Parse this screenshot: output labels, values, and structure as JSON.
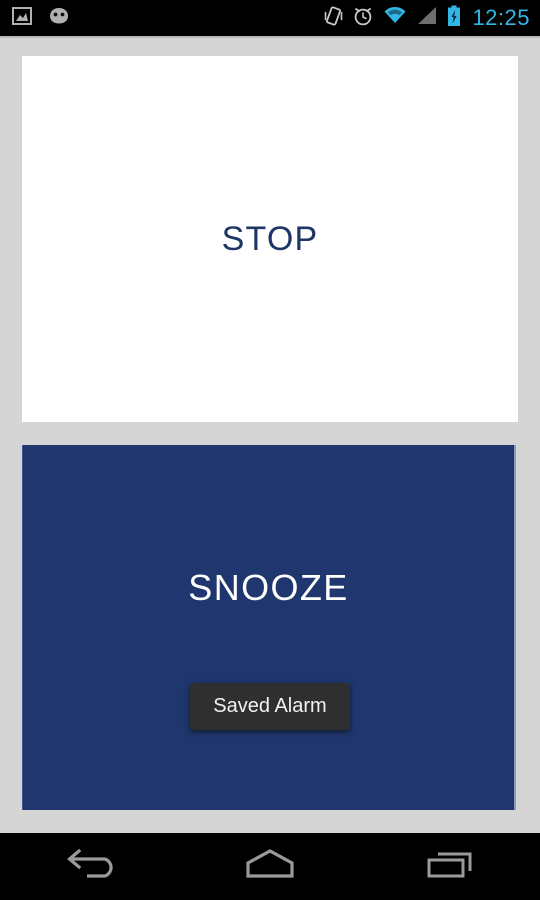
{
  "status_bar": {
    "left_icons": [
      {
        "name": "screenshot-icon",
        "label": "Screenshot"
      },
      {
        "name": "android-head-icon",
        "label": "Android System"
      }
    ],
    "right_icons": [
      {
        "name": "vibrate-icon",
        "label": "Vibrate"
      },
      {
        "name": "alarm-clock-icon",
        "label": "Alarm set"
      },
      {
        "name": "wifi-icon",
        "label": "Wi-Fi"
      },
      {
        "name": "signal-icon",
        "label": "Cellular signal"
      },
      {
        "name": "battery-charging-icon",
        "label": "Battery charging"
      }
    ],
    "clock": "12:25",
    "clock_color": "#33b5e5",
    "background": "#000000"
  },
  "screen": {
    "background": "#d5d5d5"
  },
  "stop": {
    "label": "STOP",
    "text_color": "#1f3566",
    "background": "#ffffff"
  },
  "snooze": {
    "label": "SNOOZE",
    "text_color": "#ffffff",
    "background": "#1f376e"
  },
  "toast": {
    "message": "Saved Alarm",
    "background": "#2f2f2f",
    "text_color": "#f2f2f2"
  },
  "nav_bar": {
    "buttons": [
      {
        "name": "back-button",
        "label": "Back"
      },
      {
        "name": "home-button",
        "label": "Home"
      },
      {
        "name": "recents-button",
        "label": "Recent apps"
      }
    ],
    "background": "#000000",
    "icon_color": "#9a9a9a"
  }
}
